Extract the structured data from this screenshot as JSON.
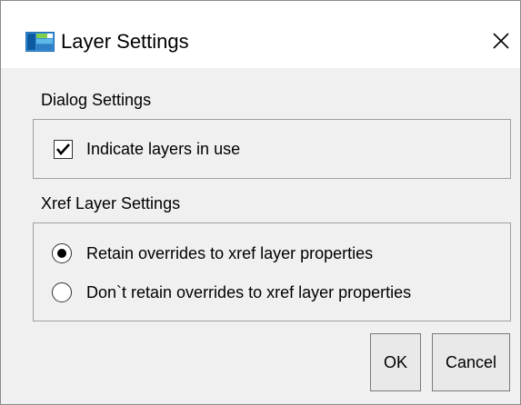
{
  "window": {
    "title": "Layer Settings",
    "app_icon": "layer-settings-app-icon",
    "close_icon": "close-icon"
  },
  "dialog_settings": {
    "label": "Dialog Settings",
    "indicate_layers": {
      "label": "Indicate layers in use",
      "checked": true
    }
  },
  "xref_settings": {
    "label": "Xref Layer Settings",
    "options": [
      {
        "label": "Retain overrides to xref layer properties",
        "selected": true
      },
      {
        "label": "Don`t retain overrides to xref layer properties",
        "selected": false
      }
    ]
  },
  "buttons": {
    "ok": "OK",
    "cancel": "Cancel"
  },
  "colors": {
    "window_bg": "#f0f0f0",
    "titlebar_bg": "#ffffff",
    "border": "#a0a0a0"
  }
}
